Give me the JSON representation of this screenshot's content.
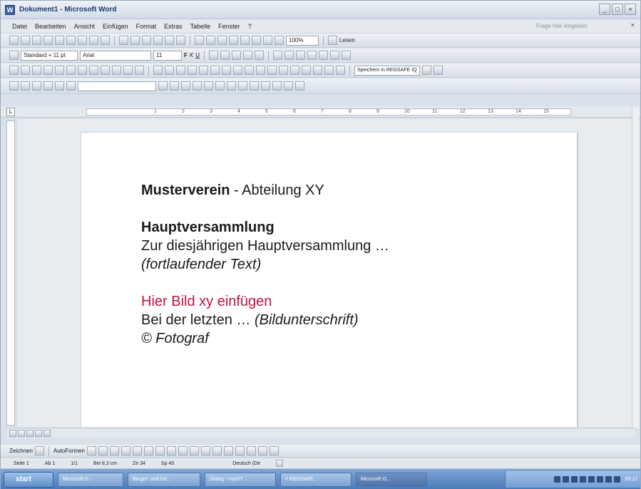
{
  "window": {
    "title": "Dokument1 - Microsoft Word",
    "controls": [
      "_",
      "□",
      "×"
    ]
  },
  "menu": {
    "items": [
      "Datei",
      "Bearbeiten",
      "Ansicht",
      "Einfügen",
      "Format",
      "Extras",
      "Tabelle",
      "Fenster",
      "?"
    ],
    "help_placeholder": "Frage hier eingeben",
    "close": "×"
  },
  "toolbar": {
    "zoom": "100%",
    "reading_mode": "Lesen",
    "style": "Standard + 11 pt",
    "font": "Arial",
    "font_size": "11",
    "bold": "F",
    "italic": "K",
    "underline": "U",
    "save_regsafe": "Speichern in REGSAFE IQ"
  },
  "ruler": {
    "corner": "L",
    "ticks": [
      "1",
      "2",
      "3",
      "4",
      "5",
      "6",
      "7",
      "8",
      "9",
      "10",
      "11",
      "12",
      "13",
      "14",
      "15"
    ]
  },
  "document": {
    "line1_bold": "Musterverein",
    "line1_rest": " - Abteilung XY",
    "heading": "Hauptversammlung",
    "body1": "Zur diesjährigen Hauptversammlung …",
    "body2": "(fortlaufender Text)",
    "image_placeholder": "Hier Bild xy einfügen",
    "caption_start": "Bei der letzten … ",
    "caption_note": "(Bildunterschrift)",
    "photographer": "© Fotograf",
    "accent_color": "#c0143c"
  },
  "drawing_toolbar": {
    "draw": "Zeichnen",
    "autoshapes": "AutoFormen"
  },
  "status": {
    "page": "Seite 1",
    "section": "Ab 1",
    "pages": "1/1",
    "position": "Bei 8,3 cm",
    "line": "Ze 34",
    "column": "Sp 40",
    "language": "Deutsch (De"
  },
  "taskbar": {
    "start": "start",
    "tasks": [
      "Microsoft O...",
      "Bürger- und Ge...",
      "Dialog - myDIT...",
      "< REGSAFE...",
      "Microsoft O..."
    ],
    "clock": "09:12"
  }
}
